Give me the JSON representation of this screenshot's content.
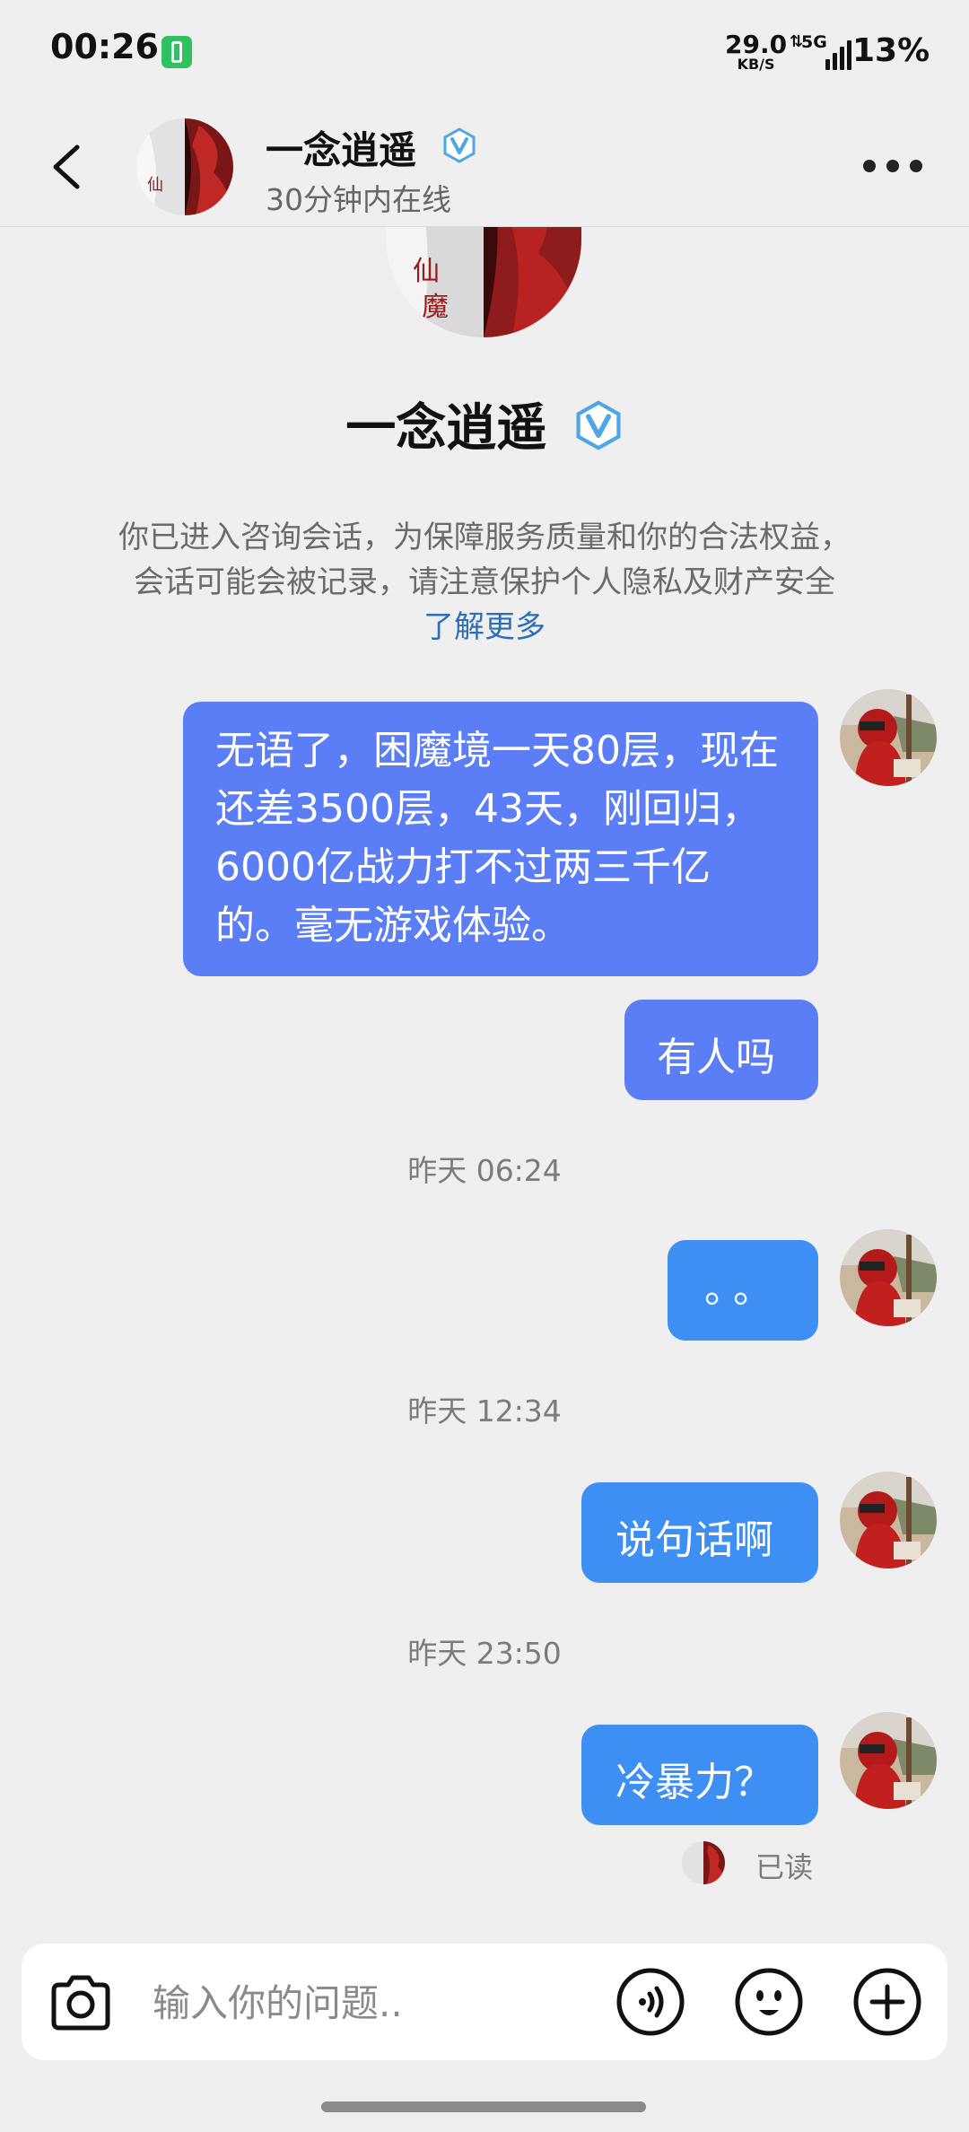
{
  "status_bar": {
    "time": "00:26",
    "net_speed_value": "29.0",
    "net_speed_unit": "KB/S",
    "network_arrows": "⇅",
    "network_type": "5G",
    "battery_percent": "13%"
  },
  "header": {
    "name": "一念逍遥",
    "online_status": "30分钟内在线",
    "verified_icon": "v-verified-icon"
  },
  "profile": {
    "name": "一念逍遥"
  },
  "notice": {
    "text": "你已进入咨询会话，为保障服务质量和你的合法权益，会话可能会被记录，请注意保护个人隐私及财产安全",
    "link": "了解更多"
  },
  "messages": [
    {
      "text": "无语了，困魔境一天80层，现在还差3500层，43天，刚回归，6000亿战力打不过两三千亿的。毫无游戏体验。"
    },
    {
      "text": "有人吗"
    },
    {
      "text": "。。"
    },
    {
      "text": "说句话啊"
    },
    {
      "text": "冷暴力？"
    }
  ],
  "timestamps": [
    "昨天 06:24",
    "昨天 12:34",
    "昨天 23:50"
  ],
  "read_receipt": "已读",
  "input": {
    "placeholder": "输入你的问题.."
  },
  "colors": {
    "bubble_purple": "#5b7df5",
    "bubble_blue": "#3d8ff4",
    "verified": "#4ea6e6",
    "link": "#2c6fb8"
  }
}
